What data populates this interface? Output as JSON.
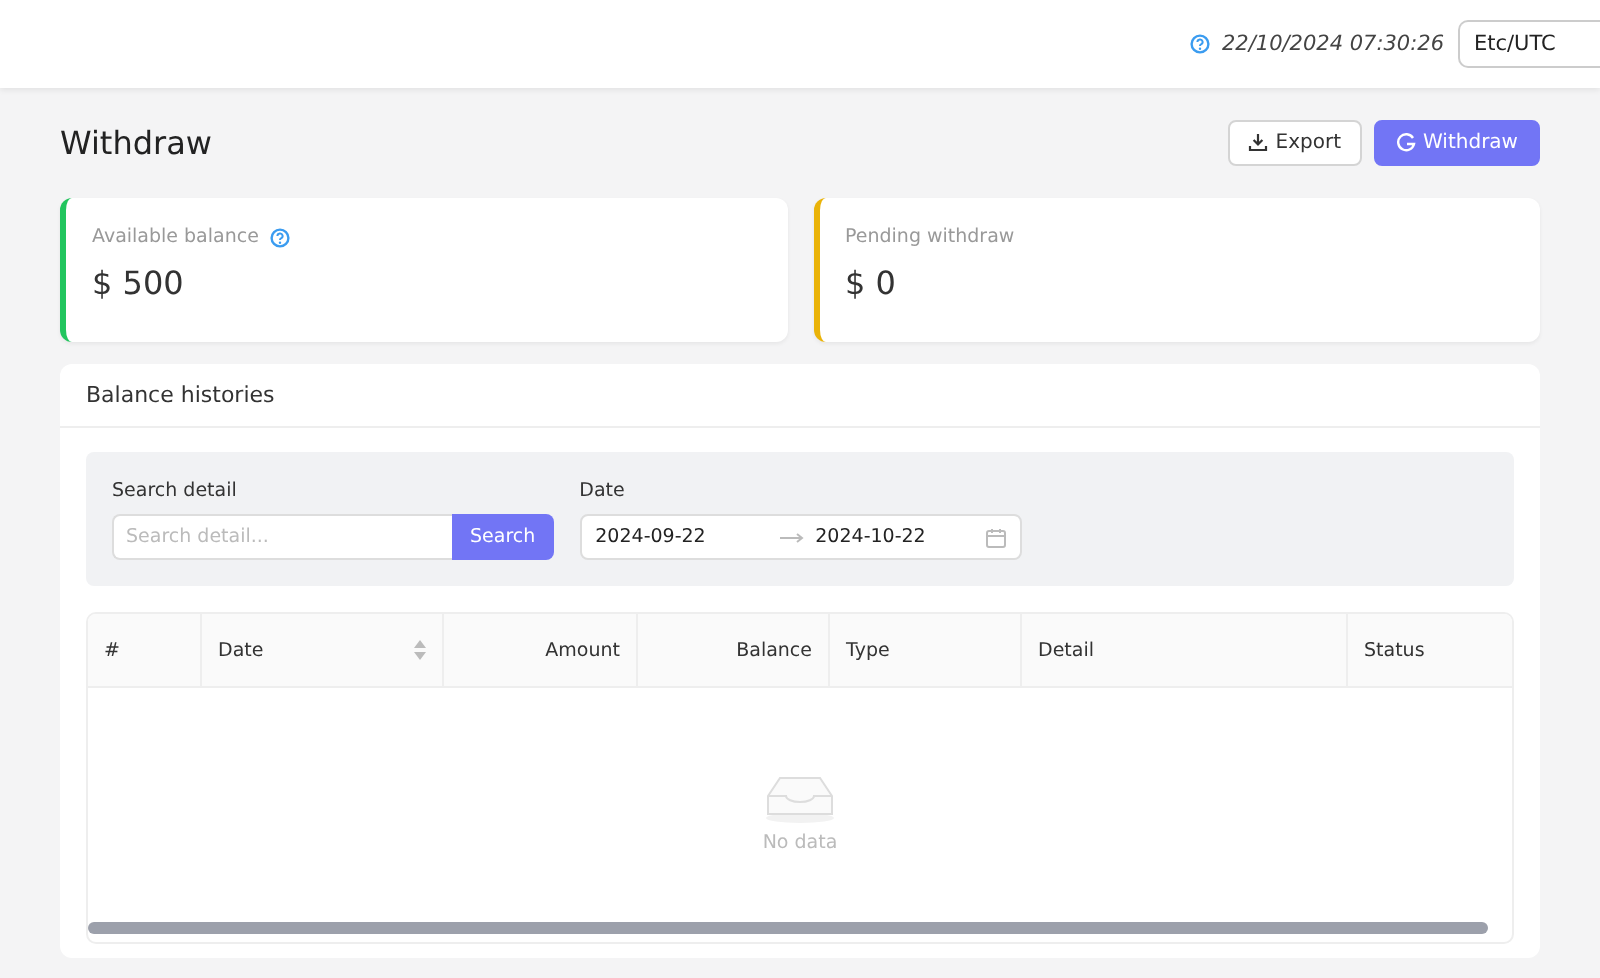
{
  "header": {
    "datetime": "22/10/2024 07:30:26",
    "timezone": "Etc/UTC"
  },
  "page": {
    "title": "Withdraw",
    "actions": [
      {
        "label": "Export",
        "kind": "secondary"
      },
      {
        "label": "Withdraw",
        "kind": "primary"
      }
    ]
  },
  "cards": [
    {
      "label": "Available balance",
      "value": "$ 500",
      "color": "#22c55e",
      "help": true
    },
    {
      "label": "Pending withdraw",
      "value": "$ 0",
      "color": "#eab308",
      "help": false
    }
  ],
  "histories": {
    "title": "Balance histories",
    "filters": {
      "search_label": "Search detail",
      "search_placeholder": "Search detail...",
      "search_button": "Search",
      "date_label": "Date",
      "date_from": "2024-09-22",
      "date_to": "2024-10-22"
    },
    "table": {
      "columns": [
        {
          "label": "#",
          "numeric": false,
          "sortable": false
        },
        {
          "label": "Date",
          "numeric": false,
          "sortable": true
        },
        {
          "label": "Amount",
          "numeric": true,
          "sortable": false
        },
        {
          "label": "Balance",
          "numeric": true,
          "sortable": false
        },
        {
          "label": "Type",
          "numeric": false,
          "sortable": false
        },
        {
          "label": "Detail",
          "numeric": false,
          "sortable": false
        },
        {
          "label": "Status",
          "numeric": false,
          "sortable": false
        }
      ],
      "empty_text": "No data"
    }
  }
}
